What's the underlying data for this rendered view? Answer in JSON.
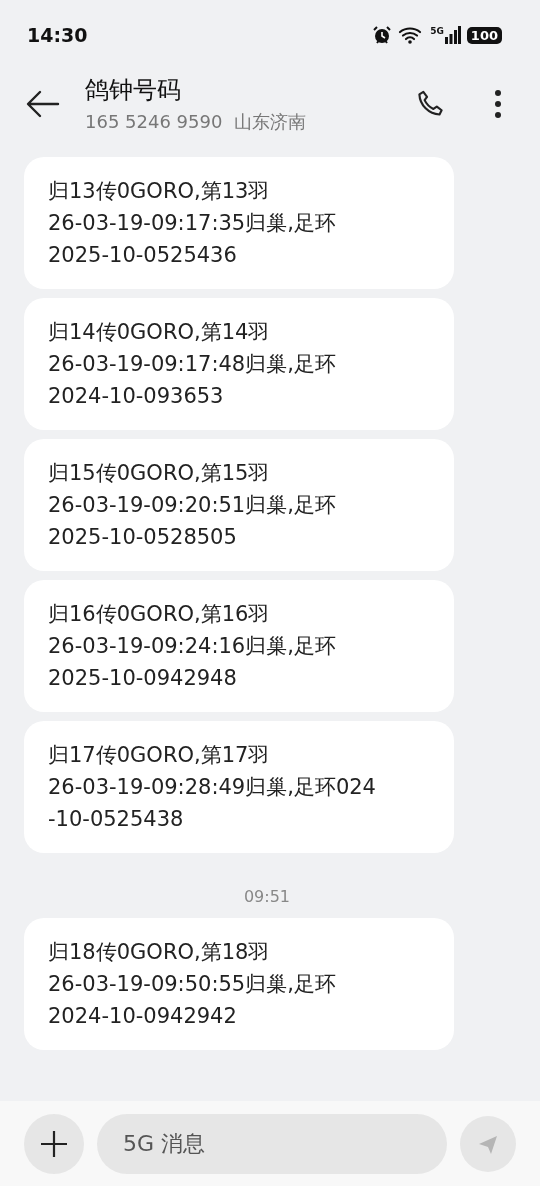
{
  "status_bar": {
    "time": "14:30",
    "network": "5G",
    "battery": "100"
  },
  "header": {
    "title": "鸽钟号码",
    "subtitle": "165 5246 9590  山东济南"
  },
  "messages": [
    {
      "kind": "bubble",
      "lines": [
        "归13传0GORO,第13羽",
        "26-03-19-09:17:35归巢,足环",
        "2025-10-0525436"
      ]
    },
    {
      "kind": "bubble",
      "lines": [
        "归14传0GORO,第14羽",
        "26-03-19-09:17:48归巢,足环",
        "2024-10-093653"
      ]
    },
    {
      "kind": "bubble",
      "lines": [
        "归15传0GORO,第15羽",
        "26-03-19-09:20:51归巢,足环",
        "2025-10-0528505"
      ]
    },
    {
      "kind": "bubble",
      "lines": [
        "归16传0GORO,第16羽",
        "26-03-19-09:24:16归巢,足环",
        "2025-10-0942948"
      ]
    },
    {
      "kind": "bubble",
      "lines": [
        "归17传0GORO,第17羽",
        "26-03-19-09:28:49归巢,足环024",
        "-10-0525438"
      ]
    },
    {
      "kind": "time",
      "text": "09:51"
    },
    {
      "kind": "bubble",
      "lines": [
        "归18传0GORO,第18羽",
        "26-03-19-09:50:55归巢,足环",
        "2024-10-0942942"
      ]
    }
  ],
  "composer": {
    "placeholder": "5G 消息"
  }
}
